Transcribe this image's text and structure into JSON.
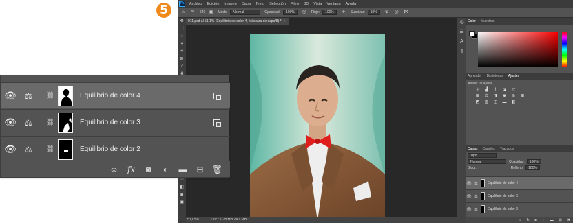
{
  "step_badge": "5",
  "app": {
    "logo": "Ps",
    "menu": [
      "Archivo",
      "Edición",
      "Imagen",
      "Capa",
      "Texto",
      "Selección",
      "Filtro",
      "3D",
      "Vista",
      "Ventana",
      "Ayuda"
    ]
  },
  "options_bar": {
    "mode_label": "Modo:",
    "mode_value": "Normal",
    "opacity_label": "Opacidad:",
    "opacity_value": "100%",
    "flow_label": "Flujo:",
    "flow_value": "100%",
    "smoothing_label": "Suavizar:",
    "smoothing_value": "10%",
    "brush_size": "540"
  },
  "document": {
    "tab_title": "911.psd al 51,1% (Equilibrio de color 4, Máscara de capa/8) *",
    "zoom": "51,05%",
    "doc_info": "Doc.: 1,28 MB/24,1 MB"
  },
  "color_panel": {
    "tabs": [
      "Color",
      "Muestras"
    ],
    "fg_color": "#ffffff",
    "bg_color": "#000000",
    "hue_color": "#ff0000"
  },
  "adjust_panel": {
    "tabs": [
      "Aprender",
      "Bibliotecas",
      "Ajustes"
    ],
    "label": "Añadir un ajuste"
  },
  "layers_panel": {
    "tabs": [
      "Capas",
      "Canales",
      "Trazados"
    ],
    "filter_value": "Tipo",
    "blend_mode": "Normal",
    "opacity_label": "Opacidad:",
    "opacity_value": "100%",
    "lock_label": "Bloq.:",
    "fill_label": "Relleno:",
    "fill_value": "100%"
  },
  "layers": [
    {
      "name": "Equilibrio de color 4",
      "selected": true,
      "clipped": true
    },
    {
      "name": "Equilibrio de color 3",
      "selected": false,
      "clipped": true
    },
    {
      "name": "Equilibrio de color 2",
      "selected": false,
      "clipped": false
    }
  ],
  "icons": {
    "eye": "eye-icon",
    "balance": "color-balance-icon",
    "chain": "link-icon",
    "footer": [
      "link-layers-icon",
      "fx-icon",
      "mask-icon",
      "adjustment-icon",
      "group-folder-icon",
      "new-layer-icon",
      "trash-icon"
    ]
  }
}
